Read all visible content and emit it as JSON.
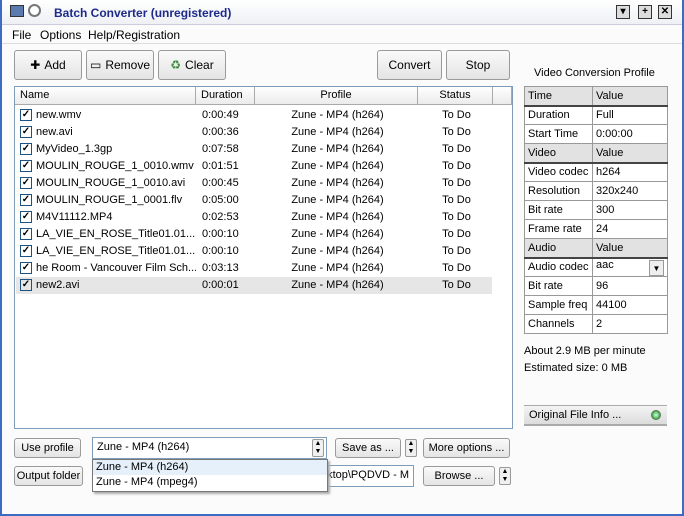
{
  "window": {
    "title": "Batch Converter  (unregistered)"
  },
  "menu": [
    "File",
    "Options",
    "Help/Registration"
  ],
  "toolbar": {
    "add": "Add",
    "remove": "Remove",
    "clear": "Clear",
    "convert": "Convert",
    "stop": "Stop"
  },
  "list": {
    "columns": [
      "Name",
      "Duration",
      "Profile",
      "Status"
    ],
    "rows": [
      {
        "name": "new.wmv",
        "duration": "0:00:49",
        "profile": "Zune - MP4 (h264)",
        "status": "To Do",
        "checked": true
      },
      {
        "name": "new.avi",
        "duration": "0:00:36",
        "profile": "Zune - MP4 (h264)",
        "status": "To Do",
        "checked": true
      },
      {
        "name": "MyVideo_1.3gp",
        "duration": "0:07:58",
        "profile": "Zune - MP4 (h264)",
        "status": "To Do",
        "checked": true
      },
      {
        "name": "MOULIN_ROUGE_1_0010.wmv",
        "duration": "0:01:51",
        "profile": "Zune - MP4 (h264)",
        "status": "To Do",
        "checked": true
      },
      {
        "name": "MOULIN_ROUGE_1_0010.avi",
        "duration": "0:00:45",
        "profile": "Zune - MP4 (h264)",
        "status": "To Do",
        "checked": true
      },
      {
        "name": "MOULIN_ROUGE_1_0001.flv",
        "duration": "0:05:00",
        "profile": "Zune - MP4 (h264)",
        "status": "To Do",
        "checked": true
      },
      {
        "name": "M4V11112.MP4",
        "duration": "0:02:53",
        "profile": "Zune - MP4 (h264)",
        "status": "To Do",
        "checked": true
      },
      {
        "name": "LA_VIE_EN_ROSE_Title01.01....",
        "duration": "0:00:10",
        "profile": "Zune - MP4 (h264)",
        "status": "To Do",
        "checked": true
      },
      {
        "name": "LA_VIE_EN_ROSE_Title01.01....",
        "duration": "0:00:10",
        "profile": "Zune - MP4 (h264)",
        "status": "To Do",
        "checked": true
      },
      {
        "name": "he Room - Vancouver Film Sch...",
        "duration": "0:03:13",
        "profile": "Zune - MP4 (h264)",
        "status": "To Do",
        "checked": true
      },
      {
        "name": "new2.avi",
        "duration": "0:00:01",
        "profile": "Zune - MP4 (h264)",
        "status": "To Do",
        "checked": true,
        "selected": true
      }
    ]
  },
  "profile_panel": {
    "title": "Video Conversion Profile",
    "rows": [
      [
        "Time",
        "Value",
        true
      ],
      [
        "Duration",
        "Full"
      ],
      [
        "Start Time",
        "0:00:00"
      ],
      [
        "Video",
        "Value",
        true
      ],
      [
        "Video codec",
        "h264"
      ],
      [
        "Resolution",
        "320x240"
      ],
      [
        "Bit rate",
        "300"
      ],
      [
        "Frame rate",
        "24"
      ],
      [
        "Audio",
        "Value",
        true
      ],
      [
        "Audio codec",
        "aac"
      ],
      [
        "Bit rate",
        "96"
      ],
      [
        "Sample freq",
        "44100"
      ],
      [
        "Channels",
        "2"
      ]
    ],
    "per_minute": "About 2.9 MB per minute",
    "estimated": "Estimated size: 0 MB",
    "original_info": "Original File Info ..."
  },
  "bottom": {
    "use_profile": "Use profile",
    "profile_value": "Zune - MP4 (h264)",
    "save_as": "Save as ...",
    "more_options": "More options ...",
    "output_folder": "Output folder",
    "folder_value": "esktop\\PQDVD - M",
    "browse": "Browse ...",
    "dropdown_options": [
      "Zune - MP4 (h264)",
      "Zune - MP4 (mpeg4)"
    ]
  }
}
